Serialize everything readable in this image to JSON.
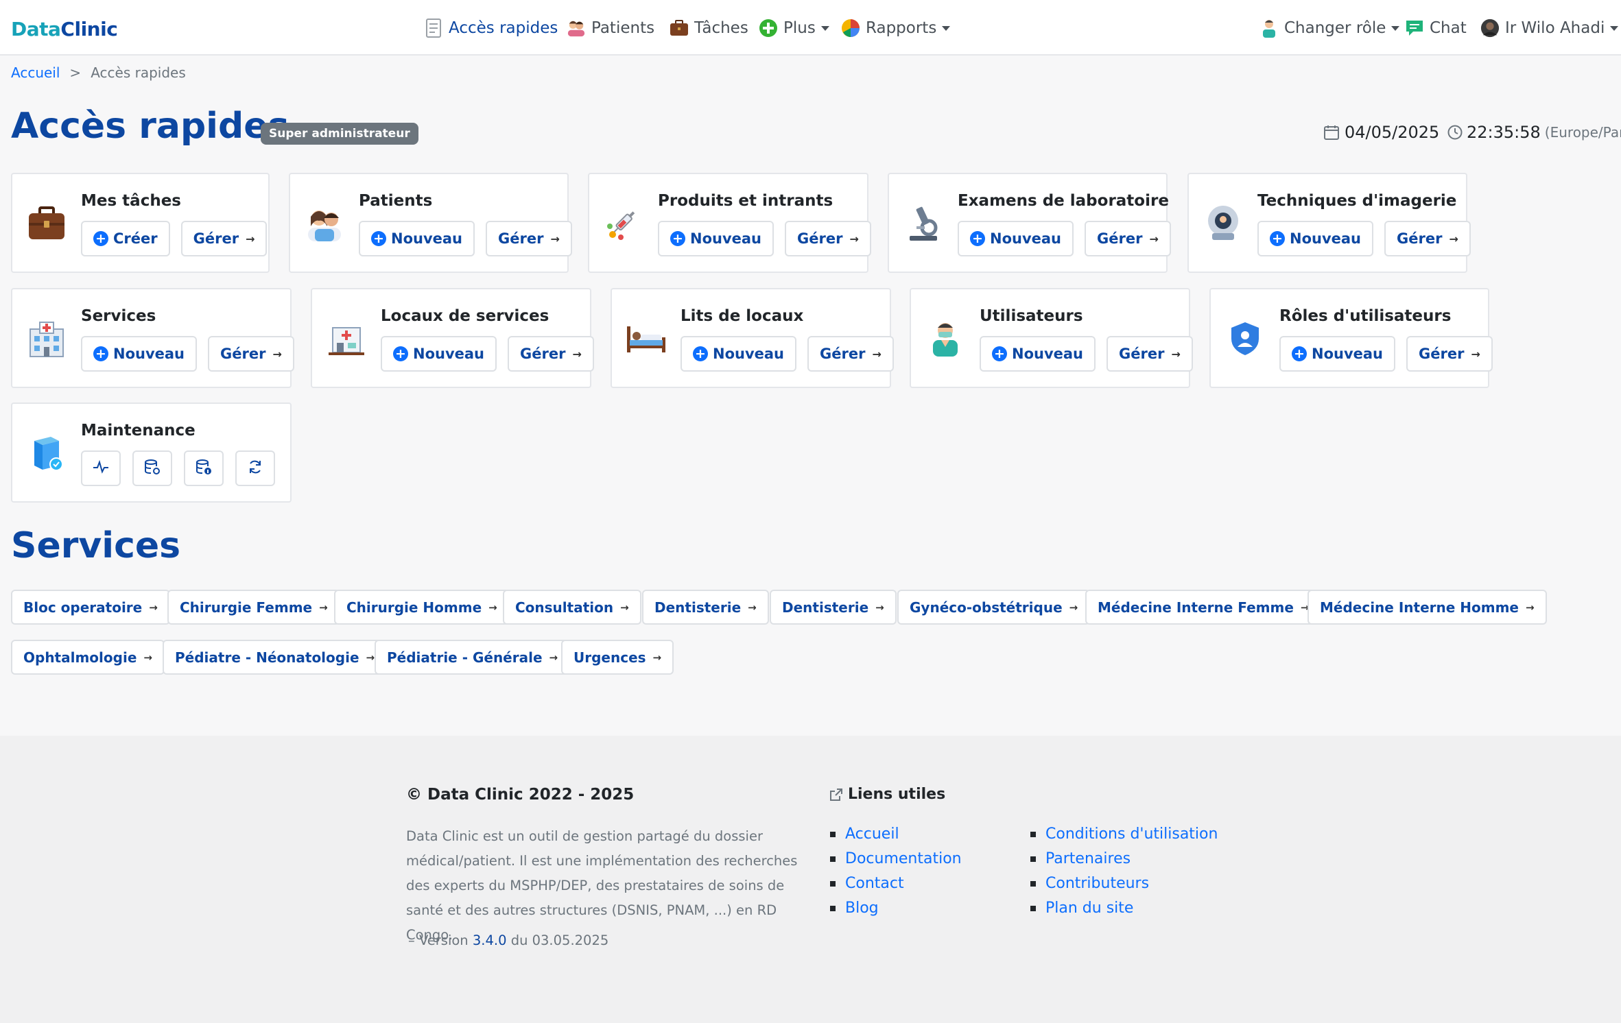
{
  "brand": {
    "part1": "Data",
    "part2": "Clinic"
  },
  "nav": {
    "acces_rapides": "Accès rapides",
    "patients": "Patients",
    "taches": "Tâches",
    "plus": "Plus",
    "rapports": "Rapports",
    "changer_role": "Changer rôle",
    "chat": "Chat",
    "user": "Ir Wilo Ahadi"
  },
  "breadcrumb": {
    "home": "Accueil",
    "sep": ">",
    "current": "Accès rapides"
  },
  "page": {
    "title": "Accès rapides",
    "role_badge": "Super administrateur"
  },
  "datetime": {
    "date": "04/05/2025",
    "time": "22:35:58",
    "timezone": "(Europe/Paris)"
  },
  "cards": {
    "mes_taches": {
      "title": "Mes tâches",
      "btn_new": "Créer",
      "btn_manage": "Gérer"
    },
    "patients": {
      "title": "Patients",
      "btn_new": "Nouveau",
      "btn_manage": "Gérer"
    },
    "produits": {
      "title": "Produits et intrants",
      "btn_new": "Nouveau",
      "btn_manage": "Gérer"
    },
    "examens": {
      "title": "Examens de laboratoire",
      "btn_new": "Nouveau",
      "btn_manage": "Gérer"
    },
    "imagerie": {
      "title": "Techniques d'imagerie",
      "btn_new": "Nouveau",
      "btn_manage": "Gérer"
    },
    "services": {
      "title": "Services",
      "btn_new": "Nouveau",
      "btn_manage": "Gérer"
    },
    "locaux": {
      "title": "Locaux de services",
      "btn_new": "Nouveau",
      "btn_manage": "Gérer"
    },
    "lits": {
      "title": "Lits de locaux",
      "btn_new": "Nouveau",
      "btn_manage": "Gérer"
    },
    "utilisateurs": {
      "title": "Utilisateurs",
      "btn_new": "Nouveau",
      "btn_manage": "Gérer"
    },
    "roles": {
      "title": "Rôles d'utilisateurs",
      "btn_new": "Nouveau",
      "btn_manage": "Gérer"
    },
    "maintenance": {
      "title": "Maintenance"
    }
  },
  "services_section": {
    "title": "Services",
    "items": [
      "Bloc operatoire",
      "Chirurgie Femme",
      "Chirurgie Homme",
      "Consultation",
      "Dentisterie",
      "Dentisterie",
      "Gynéco-obstétrique",
      "Médecine Interne Femme",
      "Médecine Interne Homme",
      "Ophtalmologie",
      "Pédiatre - Néonatologie",
      "Pédiatrie - Générale",
      "Urgences"
    ]
  },
  "footer": {
    "copyright": "© Data Clinic 2022 - 2025",
    "description": "Data Clinic est un outil de gestion partagé du dossier médical/patient. Il est une implémentation des recherches des experts du MSPHP/DEP, des prestataires de soins de santé et des autres structures (DSNIS, PNAM, ...) en RD Congo.",
    "version_prefix": "– Version",
    "version": "3.4.0",
    "version_suffix": "du 03.05.2025",
    "links_title": "Liens utiles",
    "links_col1": [
      "Accueil",
      "Documentation",
      "Contact",
      "Blog"
    ],
    "links_col2": [
      "Conditions d'utilisation",
      "Partenaires",
      "Contributeurs",
      "Plan du site"
    ]
  },
  "colors": {
    "brand_teal": "#17a2b8",
    "brand_blue": "#0d47a1",
    "link": "#0d6efd",
    "badge": "#6c757d"
  }
}
